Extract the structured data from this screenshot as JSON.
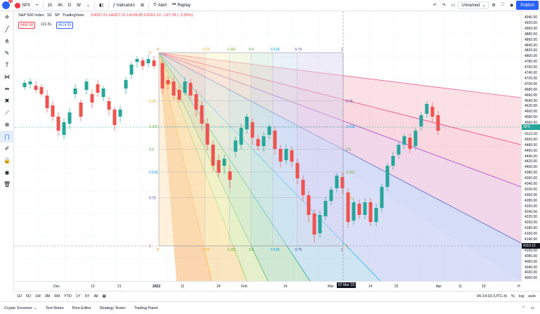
{
  "topbar": {
    "notifications": "12",
    "symbol": "SPX",
    "intervals": [
      "1h",
      "4h",
      "D",
      "W"
    ],
    "indicators_label": "Indicators",
    "alert_label": "Alert",
    "replay_label": "Replay",
    "layout_name": "Unnamed",
    "publish_label": "Publish"
  },
  "legend": {
    "title": "S&P 500 Index",
    "interval": "1D",
    "exchange": "SP",
    "source": "TradingView",
    "ohlc": "O4327.01 H4327.01 L4199.85 C4201.10 −127.78 (−2.95%)",
    "bid": "4490.98",
    "spread": "121.51",
    "ask": "4614.39"
  },
  "price_axis": {
    "ticks": [
      "4940.00",
      "4920.00",
      "4900.00",
      "4880.00",
      "4860.00",
      "4840.00",
      "4820.00",
      "4800.00",
      "4780.00",
      "4760.00",
      "4740.00",
      "4720.00",
      "4700.00",
      "4680.00",
      "4660.00",
      "4640.00",
      "4620.00",
      "4600.00",
      "4580.00",
      "4560.00",
      "4540.00",
      "4520.00",
      "4500.00",
      "4480.00",
      "4460.00",
      "4440.00",
      "4420.00",
      "4400.00",
      "4380.00",
      "4360.00",
      "4340.00",
      "4320.00",
      "4300.00",
      "4280.00",
      "4260.00",
      "4240.00",
      "4220.00",
      "4200.00",
      "4180.00",
      "4160.00",
      "4140.00",
      "4120.00",
      "4100.00",
      "4080.00",
      "4060.00",
      "4040.00",
      "4020.00",
      "4000.00"
    ],
    "last_label": "SPX",
    "last_price": "4545.87",
    "crosshair_price": "4110.12"
  },
  "time_axis": {
    "ticks": [
      "Dec",
      "13",
      "21",
      "2022",
      "11",
      "24",
      "Feb",
      "14",
      "Mar",
      "14",
      "22",
      "Apr",
      "11",
      "19",
      "H"
    ],
    "crosshair_date": "07 Mar '22"
  },
  "fib": {
    "top_labels": [
      "0",
      "0.25",
      "0.382",
      "0.5",
      "0.618",
      "0.75",
      "1"
    ],
    "left_labels": [
      "0",
      "0.25",
      "0.382",
      "0.5",
      "0.618",
      "0.75",
      "1"
    ],
    "bottom_labels": [
      "0",
      "0.25",
      "0.382",
      "0.5",
      "0.618",
      "0.75",
      "1"
    ],
    "right_labels": [
      "0.75",
      "0.618",
      "0.5",
      "0.382",
      "0.25",
      "0"
    ],
    "right_zone_labels": [
      "0.618",
      "0.5",
      "0.382",
      "0.25"
    ]
  },
  "rangebar": {
    "ranges": [
      "1D",
      "5D",
      "1M",
      "3M",
      "6M",
      "YTD",
      "1Y",
      "5Y",
      "All"
    ],
    "clock": "06:14:33 (UTC-4)",
    "pct": "%",
    "log": "log",
    "auto": "auto"
  },
  "bottom_tabs": [
    "Crypto Screener",
    "Text Notes",
    "Pine Editor",
    "Strategy Tester",
    "Trading Panel"
  ],
  "colors": {
    "accent": "#2962ff",
    "up": "#26a69a",
    "down": "#ef5350"
  }
}
